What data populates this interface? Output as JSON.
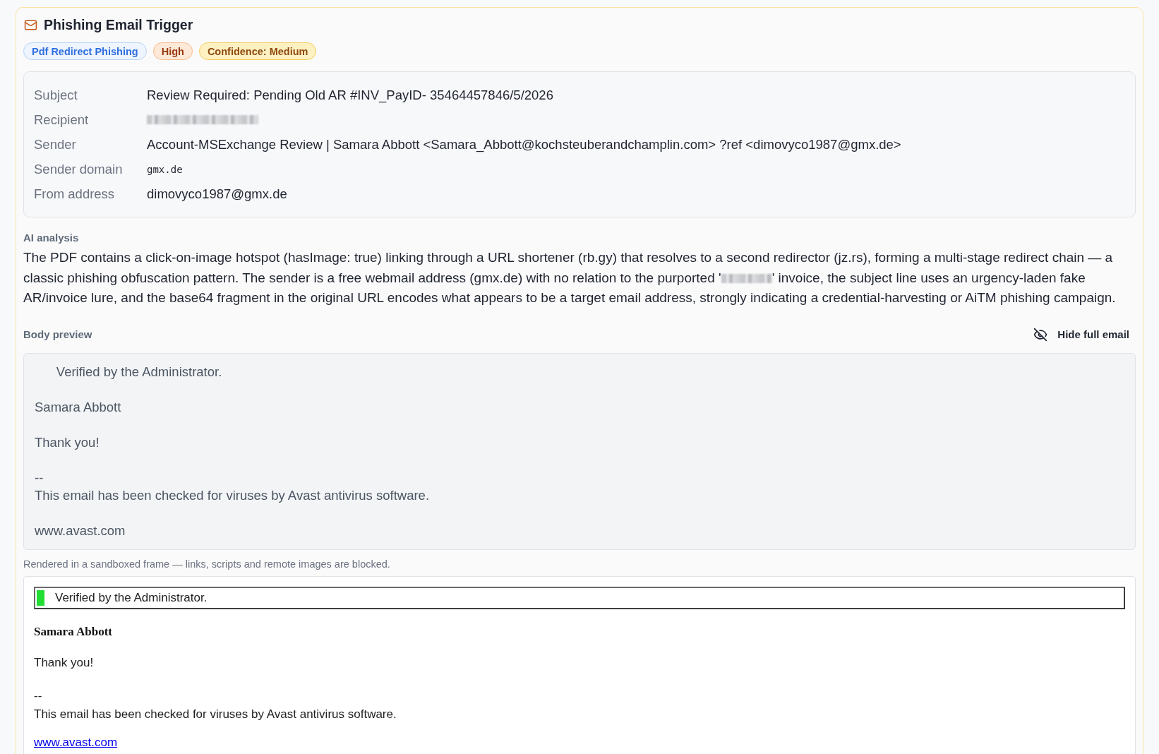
{
  "header": {
    "title": "Phishing Email Trigger"
  },
  "badges": [
    {
      "label": "Pdf Redirect Phishing",
      "kind": "category"
    },
    {
      "label": "High",
      "kind": "severity"
    },
    {
      "label": "Confidence: Medium",
      "kind": "confidence"
    }
  ],
  "details": [
    {
      "label": "Subject",
      "kind": "text",
      "value": "Review Required: Pending Old AR #INV_PayID- 35464457846/5/2026"
    },
    {
      "label": "Recipient",
      "kind": "redacted"
    },
    {
      "label": "Sender",
      "kind": "text",
      "value": "Account-MSExchange Review | Samara Abbott <Samara_Abbott@kochsteuberandchamplin.com> ?ref <dimovyco1987@gmx.de>"
    },
    {
      "label": "Sender domain",
      "kind": "mono",
      "value": "gmx.de"
    },
    {
      "label": "From address",
      "kind": "text",
      "value": "dimovyco1987@gmx.de"
    }
  ],
  "ai_analysis": {
    "label": "AI analysis",
    "parts": [
      {
        "kind": "text",
        "text": "The PDF contains a click-on-image hotspot (hasImage: true) linking through a URL shortener (rb.gy) that resolves to a second redirector (jz.rs), forming a multi-stage redirect chain — a classic phishing obfuscation pattern. The sender is a free webmail address (gmx.de) with no relation to the purported '"
      },
      {
        "kind": "redacted"
      },
      {
        "kind": "text",
        "text": "' invoice, the subject line uses an urgency-laden fake AR/invoice lure, and the base64 fragment in the original URL encodes what appears to be a target email address, strongly indicating a credential-harvesting or AiTM phishing campaign."
      }
    ]
  },
  "body_preview": {
    "label": "Body preview",
    "toggle_button": "Hide full email",
    "text": "      Verified by the Administrator.\n\nSamara Abbott\n\nThank you!\n\n--\nThis email has been checked for viruses by Avast antivirus software.\n\nwww.avast.com"
  },
  "sandbox_note": "Rendered in a sandboxed frame — links, scripts and remote images are blocked.",
  "rendered_email": {
    "banner": "Verified by the Administrator.",
    "signature": "Samara Abbott",
    "paragraphs": [
      {
        "lines": [
          "Thank you!"
        ]
      },
      {
        "lines": [
          "--",
          "This email has been checked for viruses by Avast antivirus software."
        ]
      }
    ],
    "link": "www.avast.com"
  }
}
